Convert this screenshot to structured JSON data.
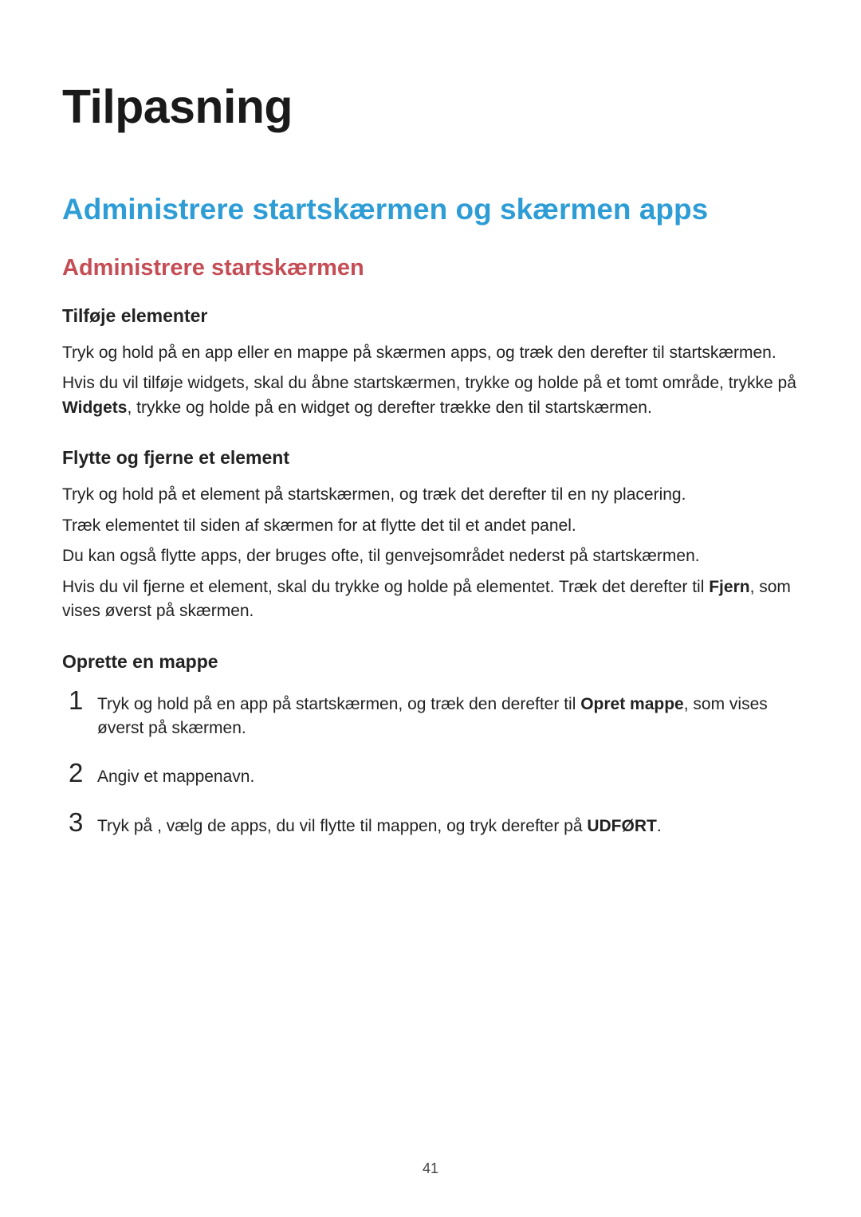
{
  "page": {
    "title": "Tilpasning",
    "section_blue": "Administrere startskærmen og skærmen apps",
    "section_red": "Administrere startskærmen",
    "sub1": {
      "heading": "Tilføje elementer",
      "p1": "Tryk og hold på en app eller en mappe på skærmen apps, og træk den derefter til startskærmen.",
      "p2_before": "Hvis du vil tilføje widgets, skal du åbne startskærmen, trykke og holde på et tomt område, trykke på ",
      "p2_bold": "Widgets",
      "p2_after": ", trykke og holde på en widget og derefter trække den til startskærmen."
    },
    "sub2": {
      "heading": "Flytte og fjerne et element",
      "p1": "Tryk og hold på et element på startskærmen, og træk det derefter til en ny placering.",
      "p2": "Træk elementet til siden af skærmen for at flytte det til et andet panel.",
      "p3": "Du kan også flytte apps, der bruges ofte, til genvejsområdet nederst på startskærmen.",
      "p4_before": "Hvis du vil fjerne et element, skal du trykke og holde på elementet. Træk det derefter til ",
      "p4_bold": "Fjern",
      "p4_after": ", som vises øverst på skærmen."
    },
    "sub3": {
      "heading": "Oprette en mappe",
      "steps": [
        {
          "num": "1",
          "before": "Tryk og hold på en app på startskærmen, og træk den derefter til ",
          "bold": "Opret mappe",
          "after": ", som vises øverst på skærmen."
        },
        {
          "num": "2",
          "before": "Angiv et mappenavn.",
          "bold": "",
          "after": ""
        },
        {
          "num": "3",
          "before": "Tryk på      , vælg de apps, du vil flytte til mappen, og tryk derefter på ",
          "bold": "UDFØRT",
          "after": "."
        }
      ]
    },
    "page_number": "41"
  }
}
